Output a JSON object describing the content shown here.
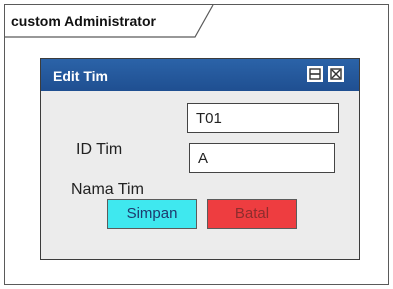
{
  "frame": {
    "title": "custom Administrator"
  },
  "dialog": {
    "title": "Edit Tim",
    "minimize_icon": "minimize-icon",
    "close_icon": "close-icon"
  },
  "form": {
    "id_label": "ID Tim",
    "id_value": "T01",
    "nama_label": "Nama Tim",
    "nama_value": "A"
  },
  "buttons": {
    "simpan": "Simpan",
    "batal": "Batal"
  },
  "colors": {
    "titlebar": "#1f4f91",
    "simpan": "#3fe8ef",
    "batal": "#ee3d40"
  }
}
